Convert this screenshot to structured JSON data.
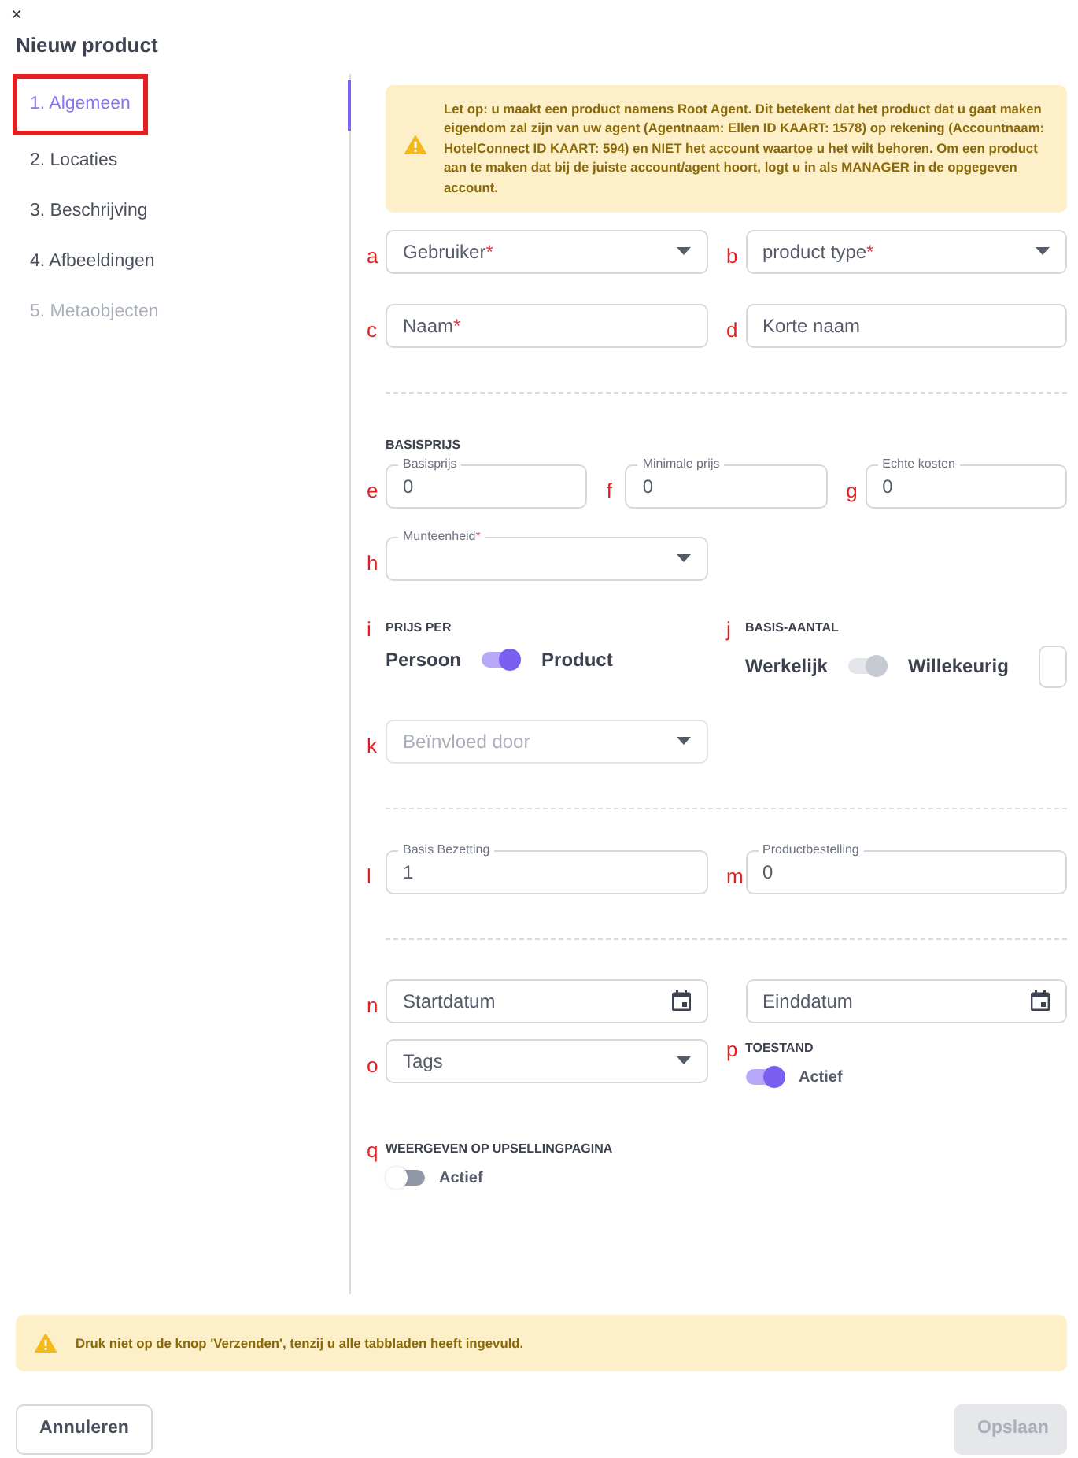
{
  "close": "×",
  "title": "Nieuw product",
  "steps": [
    {
      "label": "1. Algemeen",
      "selected": true,
      "disabled": false,
      "highlighted": true
    },
    {
      "label": "2. Locaties",
      "selected": false,
      "disabled": false,
      "highlighted": false
    },
    {
      "label": "3. Beschrijving",
      "selected": false,
      "disabled": false,
      "highlighted": false
    },
    {
      "label": "4. Afbeeldingen",
      "selected": false,
      "disabled": false,
      "highlighted": false
    },
    {
      "label": "5. Metaobjecten",
      "selected": false,
      "disabled": true,
      "highlighted": false
    }
  ],
  "notice": "Let op: u maakt een product namens Root Agent. Dit betekent dat het product dat u gaat maken eigendom zal zijn van uw agent (Agentnaam: Ellen ID KAART: 1578) op rekening (Accountnaam: HotelConnect ID KAART: 594) en NIET het account waartoe u het wilt behoren. Om een product aan te maken dat bij de juiste account/agent hoort, logt u in als MANAGER in de opgegeven account.",
  "sections": [
    {
      "rows": [
        [
          {
            "marker": "a",
            "kind": "select",
            "label": "Gebruiker",
            "required_mark": "*",
            "disabled": false
          },
          {
            "marker": "b",
            "kind": "select",
            "label": "product type",
            "required_mark": "*",
            "disabled": false
          }
        ],
        [
          {
            "marker": "c",
            "kind": "text",
            "label": "Naam",
            "required_mark": "*"
          },
          {
            "marker": "d",
            "kind": "text",
            "label": "Korte naam"
          }
        ]
      ]
    },
    {
      "title": "BASISPRIJS",
      "price_fields": [
        {
          "marker": "e",
          "kind": "outlined",
          "label": "Basisprijs",
          "value": "0"
        },
        {
          "marker": "f",
          "kind": "outlined",
          "label": "Minimale prijs",
          "value": "0"
        },
        {
          "marker": "g",
          "kind": "outlined",
          "label": "Echte kosten",
          "value": "0"
        }
      ],
      "rows": [
        [
          {
            "marker": "h",
            "kind": "outlined-select",
            "label": "Munteenheid",
            "required_mark": "*"
          }
        ],
        [
          {
            "marker": "i",
            "kind": "switch-pair",
            "heading": "PRIJS PER",
            "left": "Persoon",
            "right": "Product",
            "on": true,
            "disabled": false
          },
          {
            "marker": "j",
            "kind": "switch-pair",
            "heading": "BASIS-AANTAL",
            "left": "Werkelijk",
            "right": "Willekeurig",
            "on": true,
            "disabled": true,
            "checked": false
          }
        ],
        [
          {
            "marker": "k",
            "kind": "select",
            "label": "Beïnvloed door",
            "disabled": true
          }
        ]
      ]
    },
    {
      "rows": [
        [
          {
            "marker": "l",
            "kind": "outlined",
            "label": "Basis Bezetting",
            "value": "1"
          },
          {
            "marker": "m",
            "kind": "outlined",
            "label": "Productbestelling",
            "value": "0"
          }
        ]
      ]
    },
    {
      "rows": [
        [
          {
            "marker": "n",
            "kind": "date",
            "label": "Startdatum"
          },
          {
            "kind": "date",
            "label": "Einddatum"
          }
        ],
        [
          {
            "marker": "o",
            "kind": "select",
            "label": "Tags",
            "disabled": false
          },
          {
            "marker": "p",
            "kind": "switch",
            "heading": "TOESTAND",
            "label": "Actief",
            "on": true
          }
        ],
        [
          {
            "marker": "q",
            "kind": "switch",
            "heading": "WEERGEVEN OP UPSELLINGPAGINA",
            "label": "Actief",
            "on": false
          }
        ]
      ]
    }
  ],
  "footer_notice": "Druk niet op de knop 'Verzenden', tenzij u alle tabbladen heeft ingevuld.",
  "buttons": [
    {
      "label": "Annuleren",
      "disabled": false
    },
    {
      "label": "Opslaan",
      "disabled": true
    }
  ]
}
